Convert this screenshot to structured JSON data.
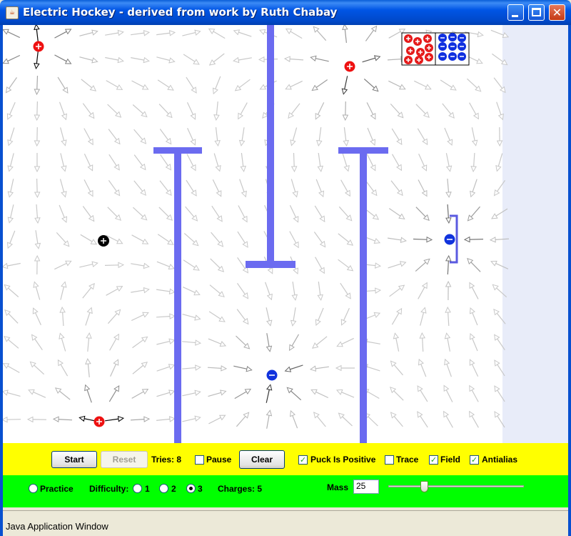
{
  "window": {
    "title": "Electric Hockey - derived from work by Ruth Chabay",
    "app_icon": "java-cup-icon"
  },
  "toolbar": {
    "start_label": "Start",
    "reset_label": "Reset",
    "tries_label": "Tries: 8",
    "pause_label": "Pause",
    "pause_checked": false,
    "clear_label": "Clear",
    "puck_positive_label": "Puck Is Positive",
    "puck_positive_checked": true,
    "trace_label": "Trace",
    "trace_checked": false,
    "field_label": "Field",
    "field_checked": true,
    "antialias_label": "Antialias",
    "antialias_checked": true
  },
  "options": {
    "practice_label": "Practice",
    "practice_selected": false,
    "difficulty_label": "Difficulty:",
    "difficulty_levels": [
      "1",
      "2",
      "3"
    ],
    "difficulty_selected": "3",
    "charges_label": "Charges: 5",
    "mass_label": "Mass",
    "mass_value": "25",
    "mass_slider_fraction": 0.25
  },
  "status": {
    "text": "Java Application Window"
  },
  "colors": {
    "title_bar": "#0055e5",
    "control_bar": "#ffff00",
    "options_bar": "#00ff00",
    "wall": "#6b6bf0",
    "positive_charge": "#ee1111",
    "negative_charge": "#1133dd",
    "puck": "#000000"
  },
  "charge_bag": {
    "positive_icon": "positive-charge-pile-icon",
    "negative_icon": "negative-charge-pile-icon"
  }
}
